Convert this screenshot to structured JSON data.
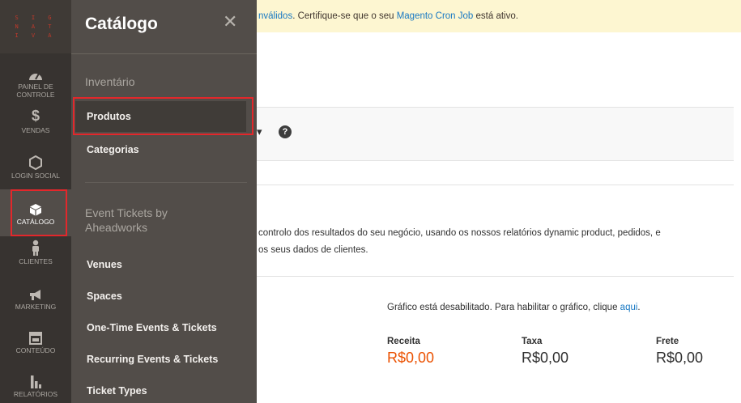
{
  "logo": {
    "lines": [
      "S I G",
      "N A T",
      "I V A"
    ]
  },
  "rail": {
    "items": [
      {
        "label": "PAINEL DE CONTROLE",
        "icon": "dashboard-icon"
      },
      {
        "label": "VENDAS",
        "icon": "dollar-icon"
      },
      {
        "label": "LOGIN SOCIAL",
        "icon": "hexagon-icon"
      },
      {
        "label": "CATÁLOGO",
        "icon": "box-icon"
      },
      {
        "label": "CLIENTES",
        "icon": "person-icon"
      },
      {
        "label": "MARKETING",
        "icon": "megaphone-icon"
      },
      {
        "label": "CONTEÚDO",
        "icon": "layout-icon"
      },
      {
        "label": "RELATÓRIOS",
        "icon": "bar-chart-icon"
      }
    ]
  },
  "flyout": {
    "title": "Catálogo",
    "close": "✕",
    "groups": [
      {
        "title": "Inventário",
        "items": [
          "Produtos",
          "Categorias"
        ]
      },
      {
        "title": "Event Tickets by Aheadworks",
        "items": [
          "Venues",
          "Spaces",
          "One-Time Events & Tickets",
          "Recurring Events & Tickets",
          "Ticket Types"
        ]
      }
    ]
  },
  "notice": {
    "link1": "nválidos",
    "text1": ". Certifique-se que o seu ",
    "link2": "Magento Cron Job",
    "text2": " está ativo."
  },
  "scope": {
    "arrow": "▾",
    "help": "?"
  },
  "intro": {
    "line1": "controlo dos resultados do seu negócio, usando os nossos relatórios dynamic product, pedidos, e",
    "line2": "os seus dados de clientes."
  },
  "graph": {
    "text": "Gráfico está desabilitado. Para habilitar o gráfico, clique ",
    "link": "aqui",
    "end": "."
  },
  "stats": [
    {
      "label": "Receita",
      "value": "R$0,00"
    },
    {
      "label": "Taxa",
      "value": "R$0,00"
    },
    {
      "label": "Frete",
      "value": "R$0,00"
    }
  ],
  "colors": {
    "highlight": "#e3272b",
    "revenue": "#eb5202",
    "link": "#1979c3"
  }
}
